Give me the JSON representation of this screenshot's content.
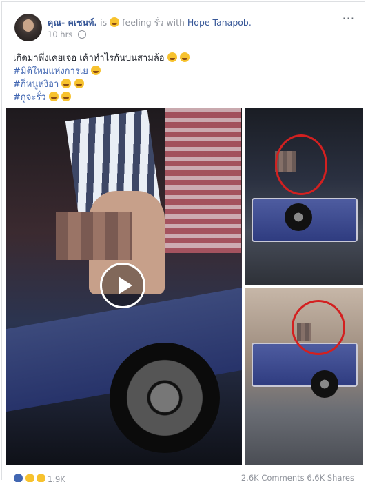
{
  "post": {
    "author": "คุณ- คเชนท์.",
    "connector_is": "is",
    "feeling_text": "feeling รั่ว with",
    "tagged": "Hope Tanapob.",
    "time": "10 hrs",
    "more_label": "···",
    "lines": [
      "เกิดมาพึ่งเคยเจอ เค้าทำไรกันบนสามล้อ",
      "#มิติใหมแห่งการเย",
      "#ก็หนูหงิอา",
      "#กูจะรั่ว"
    ]
  },
  "stats": {
    "reactions": "1.9K",
    "comments": "2.6K Comments",
    "shares": "6.6K Shares"
  },
  "colors": {
    "link": "#385898",
    "hashtag": "#4267b2",
    "meta": "#90949c",
    "annotation_circle": "#d32020"
  },
  "icons": [
    "globe-icon",
    "more-options-icon",
    "play-icon",
    "like-reaction-icon",
    "wow-reaction-icon",
    "emoji-icon"
  ]
}
